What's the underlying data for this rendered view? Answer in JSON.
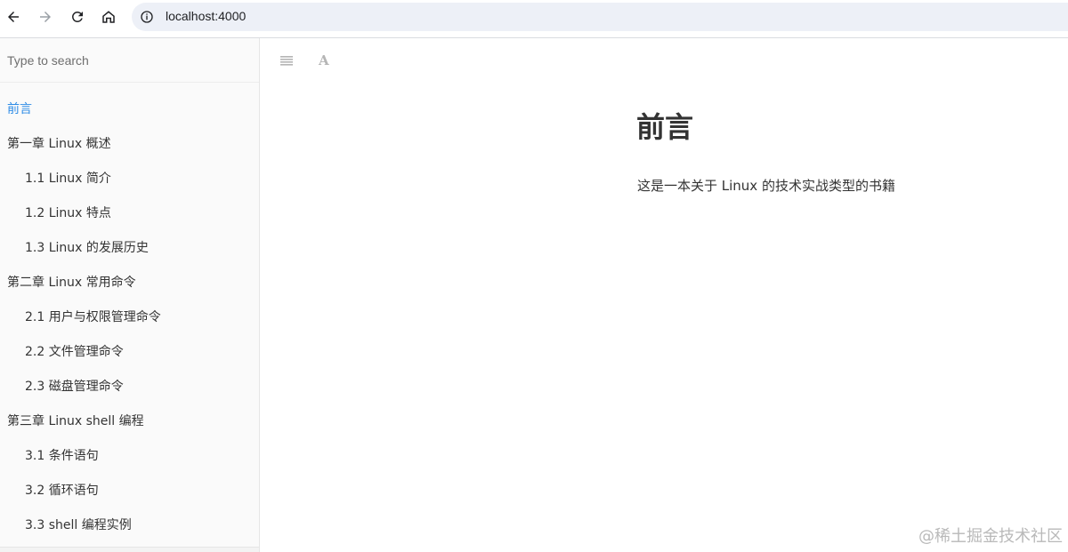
{
  "browser": {
    "url": "localhost:4000",
    "icons": {
      "back": "arrow-left-icon",
      "forward": "arrow-right-icon",
      "reload": "reload-icon",
      "home": "home-icon",
      "site_info": "info-icon"
    }
  },
  "sidebar": {
    "search_placeholder": "Type to search",
    "items": [
      {
        "label": "前言",
        "level": 1,
        "active": true
      },
      {
        "label": "第一章 Linux 概述",
        "level": 1,
        "active": false
      },
      {
        "label": "1.1 Linux 简介",
        "level": 2,
        "active": false
      },
      {
        "label": "1.2 Linux 特点",
        "level": 2,
        "active": false
      },
      {
        "label": "1.3 Linux 的发展历史",
        "level": 2,
        "active": false
      },
      {
        "label": "第二章 Linux 常用命令",
        "level": 1,
        "active": false
      },
      {
        "label": "2.1 用户与权限管理命令",
        "level": 2,
        "active": false
      },
      {
        "label": "2.2 文件管理命令",
        "level": 2,
        "active": false
      },
      {
        "label": "2.3 磁盘管理命令",
        "level": 2,
        "active": false
      },
      {
        "label": "第三章 Linux shell 编程",
        "level": 1,
        "active": false
      },
      {
        "label": "3.1 条件语句",
        "level": 2,
        "active": false
      },
      {
        "label": "3.2 循环语句",
        "level": 2,
        "active": false
      },
      {
        "label": "3.3 shell 编程实例",
        "level": 2,
        "active": false
      }
    ]
  },
  "book_toolbar": {
    "toggle_icon": "menu-icon",
    "font_icon": "font-settings-icon",
    "font_glyph": "A"
  },
  "content": {
    "title": "前言",
    "paragraph": "这是一本关于 Linux 的技术实战类型的书籍"
  },
  "watermark": "@稀土掘金技术社区",
  "colors": {
    "accent": "#2e8ce6",
    "text": "#333333",
    "sidebar_bg": "#fafafa",
    "urlbar_bg": "#edf0f7"
  }
}
